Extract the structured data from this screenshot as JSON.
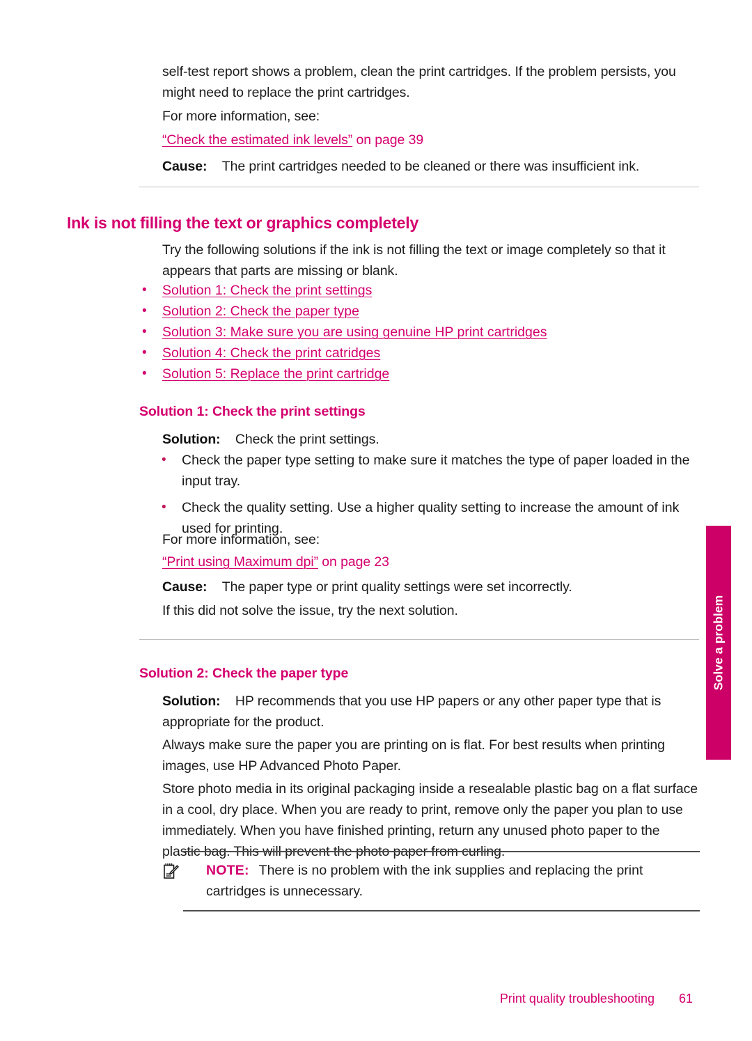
{
  "page": {
    "number": "61",
    "footer_title": "Print quality troubleshooting",
    "side_tab_label": "Solve a problem"
  },
  "intro": {
    "paragraph": "self-test report shows a problem, clean the print cartridges. If the problem persists, you might need to replace the print cartridges.",
    "see_more": "For more information, see:",
    "link_text": "“Check the estimated ink levels”",
    "link_tail": " on page 39",
    "cause_label": "Cause:",
    "cause_text": "The print cartridges needed to be cleaned or there was insufficient ink."
  },
  "section": {
    "heading": "Ink is not filling the text or graphics completely",
    "intro": "Try the following solutions if the ink is not filling the text or image completely so that it appears that parts are missing or blank.",
    "solution_links": [
      "Solution 1: Check the print settings",
      "Solution 2: Check the paper type",
      "Solution 3: Make sure you are using genuine HP print cartridges",
      "Solution 4: Check the print catridges",
      "Solution 5: Replace the print cartridge"
    ]
  },
  "solution1": {
    "heading": "Solution 1: Check the print settings",
    "solution_label": "Solution:",
    "solution_text": "Check the print settings.",
    "bullets": [
      "Check the paper type setting to make sure it matches the type of paper loaded in the input tray.",
      "Check the quality setting. Use a higher quality setting to increase the amount of ink used for printing."
    ],
    "see_more": "For more information, see:",
    "link_text": "“Print using Maximum dpi”",
    "link_tail": " on page 23",
    "cause_label": "Cause:",
    "cause_text": "The paper type or print quality settings were set incorrectly.",
    "next": "If this did not solve the issue, try the next solution."
  },
  "solution2": {
    "heading": "Solution 2: Check the paper type",
    "solution_label": "Solution:",
    "solution_text": "HP recommends that you use HP papers or any other paper type that is appropriate for the product.",
    "paragraph2": "Always make sure the paper you are printing on is flat. For best results when printing images, use HP Advanced Photo Paper.",
    "paragraph3": "Store photo media in its original packaging inside a resealable plastic bag on a flat surface in a cool, dry place. When you are ready to print, remove only the paper you plan to use immediately. When you have finished printing, return any unused photo paper to the plastic bag. This will prevent the photo paper from curling.",
    "note_label": "NOTE:",
    "note_text": "There is no problem with the ink supplies and replacing the print cartridges is unnecessary."
  },
  "colors": {
    "magenta": "#d4006e",
    "tab_magenta": "#cc0066",
    "rule_light": "#bdbdbd",
    "rule_dark": "#4d4d4d"
  }
}
